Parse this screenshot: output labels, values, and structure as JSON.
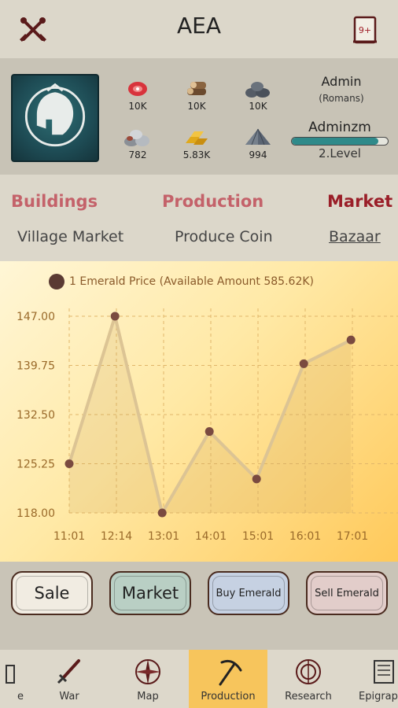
{
  "header": {
    "title": "AEA",
    "notifications_badge": "9+"
  },
  "resources": [
    {
      "icon": "meat-icon",
      "value": "10K"
    },
    {
      "icon": "wood-icon",
      "value": "10K"
    },
    {
      "icon": "stone-icon",
      "value": "10K"
    },
    {
      "icon": "iron-icon",
      "value": "782"
    },
    {
      "icon": "gold-icon",
      "value": "5.83K"
    },
    {
      "icon": "emerald-icon",
      "value": "994"
    }
  ],
  "user": {
    "name": "Admin",
    "civilization": "(Romans)",
    "nickname": "Adminzm",
    "level": "2.Level",
    "level_progress": 0.9
  },
  "tabs": [
    {
      "label": "Buildings",
      "active": false
    },
    {
      "label": "Production",
      "active": false
    },
    {
      "label": "Market",
      "active": true
    }
  ],
  "subtabs": [
    {
      "label": "Village Market",
      "active": false
    },
    {
      "label": "Produce Coin",
      "active": false
    },
    {
      "label": "Bazaar",
      "active": true
    }
  ],
  "chart_data": {
    "type": "line",
    "legend": "1 Emerald Price (Available Amount 585.62K)",
    "categories": [
      "11:01",
      "12:14",
      "13:01",
      "14:01",
      "15:01",
      "16:01",
      "17:01"
    ],
    "x_points": [
      0,
      1,
      2,
      3,
      4,
      5,
      6
    ],
    "y_ticks": [
      "147.00",
      "139.75",
      "132.50",
      "125.25",
      "118.00"
    ],
    "ylim": [
      118,
      147
    ],
    "series": [
      {
        "name": "1 Emerald Price",
        "x": [
          0,
          0.97,
          1.97,
          2.97,
          3.97,
          4.97,
          5.97
        ],
        "values": [
          125.25,
          147.0,
          118.0,
          130.0,
          123.0,
          140.0,
          143.5
        ]
      }
    ],
    "grid": true
  },
  "actions": [
    {
      "label": "Sale"
    },
    {
      "label": "Market"
    },
    {
      "label": "Buy Emerald"
    },
    {
      "label": "Sell Emerald"
    }
  ],
  "nav": [
    {
      "label": "e",
      "icon": "home-icon",
      "active": false
    },
    {
      "label": "War",
      "icon": "sword-icon",
      "active": false
    },
    {
      "label": "Map",
      "icon": "compass-icon",
      "active": false
    },
    {
      "label": "Production",
      "icon": "pickaxe-icon",
      "active": true
    },
    {
      "label": "Research",
      "icon": "research-icon",
      "active": false
    },
    {
      "label": "Epigrap",
      "icon": "scroll-icon",
      "active": false
    }
  ],
  "colors": {
    "tab_inactive": "#c4626a",
    "tab_active": "#9a1e28",
    "line": "#dcc494",
    "point": "#7a4a40",
    "nav_active": "#f7c55c"
  }
}
